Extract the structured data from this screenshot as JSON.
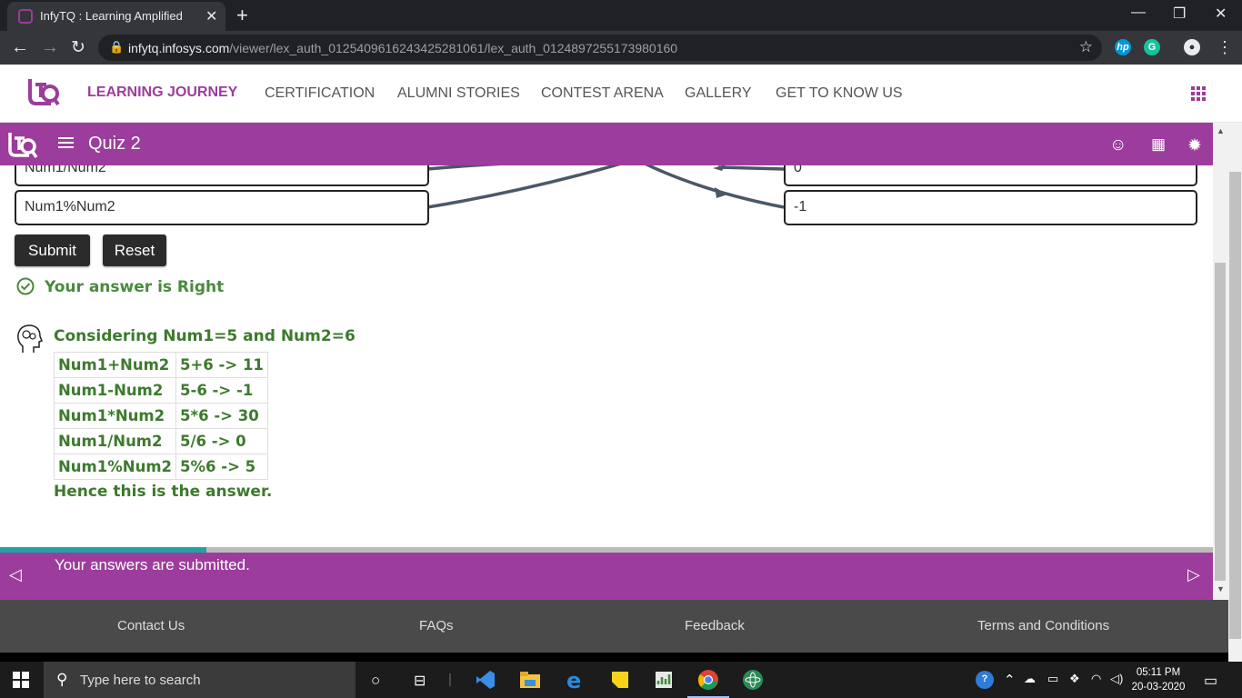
{
  "browser": {
    "tab_title": "InfyTQ : Learning Amplified",
    "url_host": "infytq.infosys.com",
    "url_path": "/viewer/lex_auth_012540961624342528106​1/lex_auth_012489725517398016​0"
  },
  "site_nav": {
    "items": [
      {
        "label": "LEARNING JOURNEY",
        "active": true
      },
      {
        "label": "CERTIFICATION"
      },
      {
        "label": "ALUMNI STORIES"
      },
      {
        "label": "CONTEST ARENA"
      },
      {
        "label": "GALLERY"
      },
      {
        "label": "GET TO KNOW US"
      }
    ]
  },
  "viewer": {
    "quiz_title": "Quiz 2"
  },
  "matching": {
    "left": [
      "Num1/Num2",
      "Num1%Num2"
    ],
    "right": [
      "0",
      "-1"
    ]
  },
  "actions": {
    "submit": "Submit",
    "reset": "Reset"
  },
  "result": {
    "text": "Your answer is Right"
  },
  "explanation": {
    "heading": "Considering Num1=5 and Num2=6",
    "rows": [
      [
        "Num1+Num2",
        "5+6 -> 11"
      ],
      [
        "Num1-Num2",
        "5-6 -> -1"
      ],
      [
        "Num1*Num2",
        "5*6 -> 30"
      ],
      [
        "Num1/Num2",
        "5/6 -> 0"
      ],
      [
        "Num1%Num2",
        "5%6 -> 5"
      ]
    ],
    "footer": "Hence this is the answer."
  },
  "progress": {
    "fraction": 0.17
  },
  "status": {
    "text": "Your answers are submitted."
  },
  "footer_links": [
    "Contact Us",
    "FAQs",
    "Feedback",
    "Terms and Conditions"
  ],
  "taskbar": {
    "search_placeholder": "Type here to search",
    "time": "05:11 PM",
    "date": "20-03-2020"
  },
  "colors": {
    "brand_purple": "#9c3c9c",
    "answer_green": "#3d7a2d",
    "progress_teal": "#22a3a3"
  }
}
